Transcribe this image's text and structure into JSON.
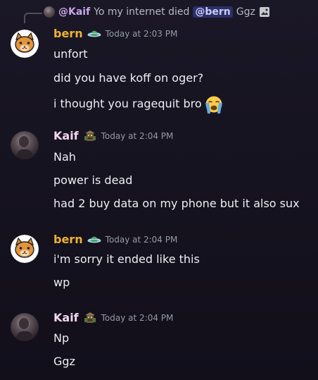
{
  "reply": {
    "author": "@Kaif",
    "text_before": "Yo my internet died",
    "mention": "@bern",
    "text_after": "Ggz",
    "attachment_icon": "image-icon"
  },
  "messages": [
    {
      "author": "bern",
      "badge_icon": "planet-icon",
      "timestamp": "Today at 2:03 PM",
      "lines": [
        "unfort",
        "did you have koff on oger?",
        "i thought you ragequit bro"
      ],
      "emoji": "loudly-crying-face-emoji"
    },
    {
      "author": "Kaif",
      "badge_icon": "tiki-icon",
      "timestamp": "Today at 2:04 PM",
      "lines": [
        "Nah",
        "power is dead",
        "had 2 buy data on my phone but it also sux"
      ]
    },
    {
      "author": "bern",
      "badge_icon": "planet-icon",
      "timestamp": "Today at 2:04 PM",
      "lines": [
        "i'm sorry it ended like this",
        "wp"
      ]
    },
    {
      "author": "Kaif",
      "badge_icon": "tiki-icon",
      "timestamp": "Today at 2:04 PM",
      "lines": [
        "Np",
        "Ggz"
      ]
    }
  ],
  "colors": {
    "background": "#15121e",
    "bern_name": "#f0b232",
    "kaif_name": "#f3d7f2",
    "timestamp": "#949ba4",
    "mention_bg": "#3c4270"
  }
}
